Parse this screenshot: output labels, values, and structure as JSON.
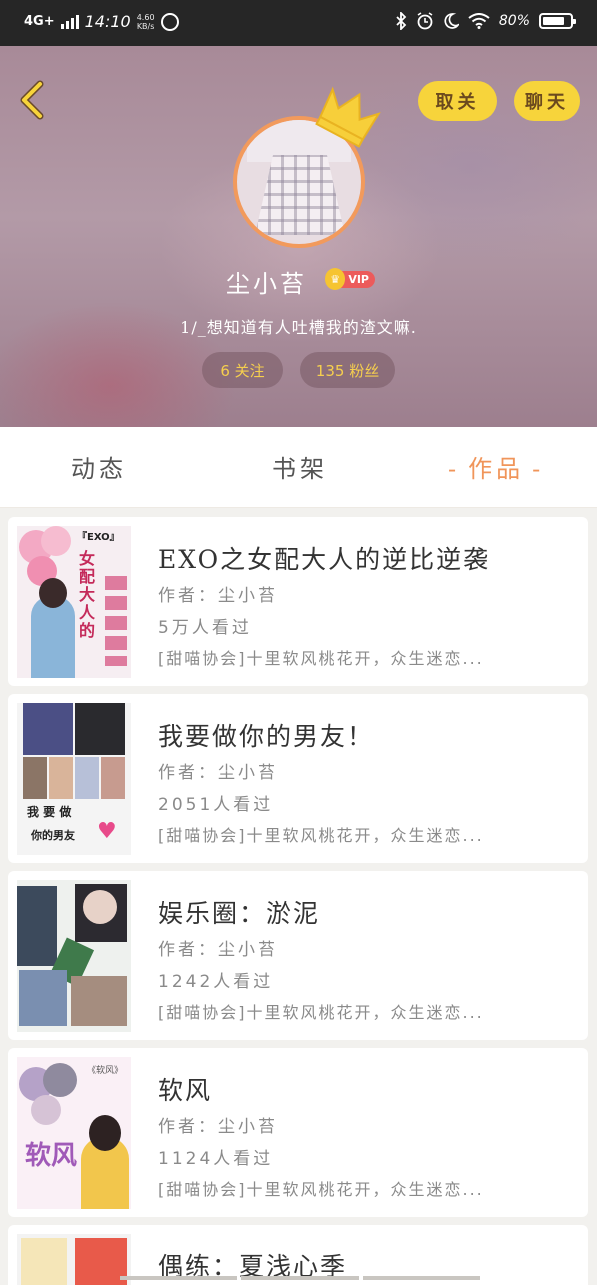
{
  "status_bar": {
    "network": "4G+",
    "time": "14:10",
    "speed_value": "4.60",
    "speed_unit": "KB/s",
    "battery": "80%",
    "battery_level": 0.8
  },
  "header": {
    "unfollow_label": "取关",
    "chat_label": "聊天",
    "username": "尘小苔",
    "vip_label": "VIP",
    "bio": "1/_想知道有人吐槽我的渣文嘛.",
    "following": "6 关注",
    "fans": "135 粉丝"
  },
  "tabs": {
    "dynamic": "动态",
    "shelf": "书架",
    "works": "作品",
    "dash": "-"
  },
  "works": [
    {
      "title": "EXO之女配大人的逆比逆袭",
      "author": "作者：尘小苔",
      "views": "5万人看过",
      "desc": "[甜喵协会]十里软风桃花开，众生迷恋...",
      "cover_text": "『EXO』",
      "cover_title": "女配大人的"
    },
    {
      "title": "我要做你的男友！",
      "author": "作者：尘小苔",
      "views": "2051人看过",
      "desc": "[甜喵协会]十里软风桃花开，众生迷恋...",
      "cover_text": "我 要 做",
      "cover_title": "你的男友"
    },
    {
      "title": "娱乐圈：淤泥",
      "author": "作者：尘小苔",
      "views": "1242人看过",
      "desc": "[甜喵协会]十里软风桃花开，众生迷恋...",
      "cover_text": "",
      "cover_title": ""
    },
    {
      "title": "软风",
      "author": "作者：尘小苔",
      "views": "1124人看过",
      "desc": "[甜喵协会]十里软风桃花开，众生迷恋...",
      "cover_text": "《软风》",
      "cover_title": "软风"
    },
    {
      "title": "偶练：夏浅心季",
      "author": "",
      "views": "",
      "desc": "",
      "cover_text": "",
      "cover_title": ""
    }
  ]
}
